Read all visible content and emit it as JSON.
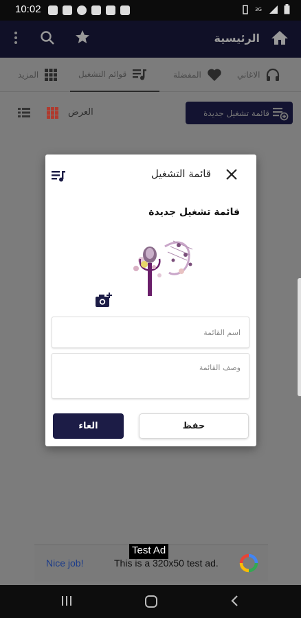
{
  "status_bar": {
    "time": "10:02",
    "battery_text": ""
  },
  "app_bar": {
    "title": "الرئيسية"
  },
  "tabs": [
    {
      "label": "الاغاني",
      "icon": "headphones-icon"
    },
    {
      "label": "المفضلة",
      "icon": "heart-icon"
    },
    {
      "label": "قوائم التشغيل",
      "icon": "playlist-icon"
    },
    {
      "label": "المزيد",
      "icon": "grid-icon"
    }
  ],
  "toolbar": {
    "new_playlist_label": "قائمة تشغيل جديدة",
    "view_label": "العرض"
  },
  "dialog": {
    "title": "قائمة التشغيل",
    "subtitle": "قائمة تشغيل جديدة",
    "name_placeholder": "اسم القائمة",
    "desc_placeholder": "وصف القائمة",
    "save_label": "حفظ",
    "cancel_label": "الغاء"
  },
  "ad": {
    "tag": "Test Ad",
    "nice": "Nice job!",
    "text": "This is a 320x50 test ad."
  },
  "colors": {
    "app_bar": "#101027",
    "cancel_button": "#1c1c46",
    "view_grid": "#c0392b"
  }
}
